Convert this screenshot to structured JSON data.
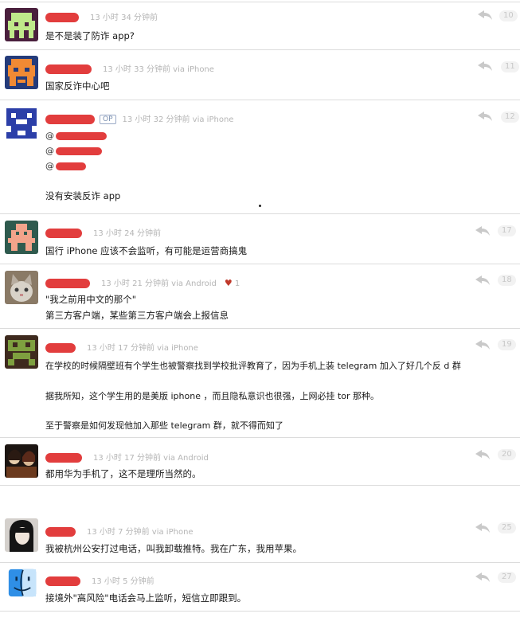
{
  "replies": [
    {
      "time": "13 小时 34 分钟前",
      "via": "",
      "floor": "10",
      "lines": [
        "是不是装了防诈 app?"
      ],
      "avatar": "green-pixel-avatar"
    },
    {
      "time": "13 小时 33 分钟前 via iPhone",
      "via": "",
      "floor": "11",
      "lines": [
        "国家反诈中心吧"
      ],
      "avatar": "orange-pixel-avatar"
    },
    {
      "time": "13 小时 32 分钟前 via iPhone",
      "op": "OP",
      "floor": "12",
      "mentions": [
        "@",
        "@",
        "@"
      ],
      "lines": [
        "没有安装反诈 app"
      ],
      "avatar": "blue-pixel-avatar"
    },
    {
      "time": "13 小时 24 分钟前",
      "floor": "17",
      "lines": [
        "国行 iPhone 应该不会监听，有可能是运营商搞鬼"
      ],
      "avatar": "salmon-pixel-avatar"
    },
    {
      "time": "13 小时 21 分钟前 via Android",
      "floor": "18",
      "likes": "1",
      "lines": [
        "\"我之前用中文的那个\"",
        "第三方客户端，某些第三方客户端会上报信息"
      ],
      "avatar": "cat-photo-avatar"
    },
    {
      "time": "13 小时 17 分钟前 via iPhone",
      "floor": "19",
      "lines": [
        "在学校的时候隔壁班有个学生也被警察找到学校批评教育了，因为手机上装 telegram 加入了好几个反 d 群",
        "据我所知，这个学生用的是美版 iphone ，而且隐私意识也很强，上网必挂 tor 那种。",
        "至于警察是如何发现他加入那些 telegram 群，就不得而知了"
      ],
      "avatar": "olive-pixel-avatar"
    },
    {
      "time": "13 小时 17 分钟前 via Android",
      "floor": "20",
      "lines": [
        "都用华为手机了，这不是理所当然的。"
      ],
      "avatar": "anime-photo-avatar"
    },
    {
      "time": "13 小时 7 分钟前 via iPhone",
      "floor": "25",
      "lines": [
        "我被杭州公安打过电话，叫我卸载推特。我在广东，我用苹果。"
      ],
      "avatar": "dark-anime-avatar"
    },
    {
      "time": "13 小时 5 分钟前",
      "floor": "27",
      "lines": [
        "接境外\"高风险\"电话会马上监听，短信立即跟到。"
      ],
      "avatar": "finder-face-avatar"
    }
  ],
  "colors": {
    "redaction": "#e23d3d",
    "meta": "#b5b5b5",
    "op_border": "#9aa9c6"
  }
}
